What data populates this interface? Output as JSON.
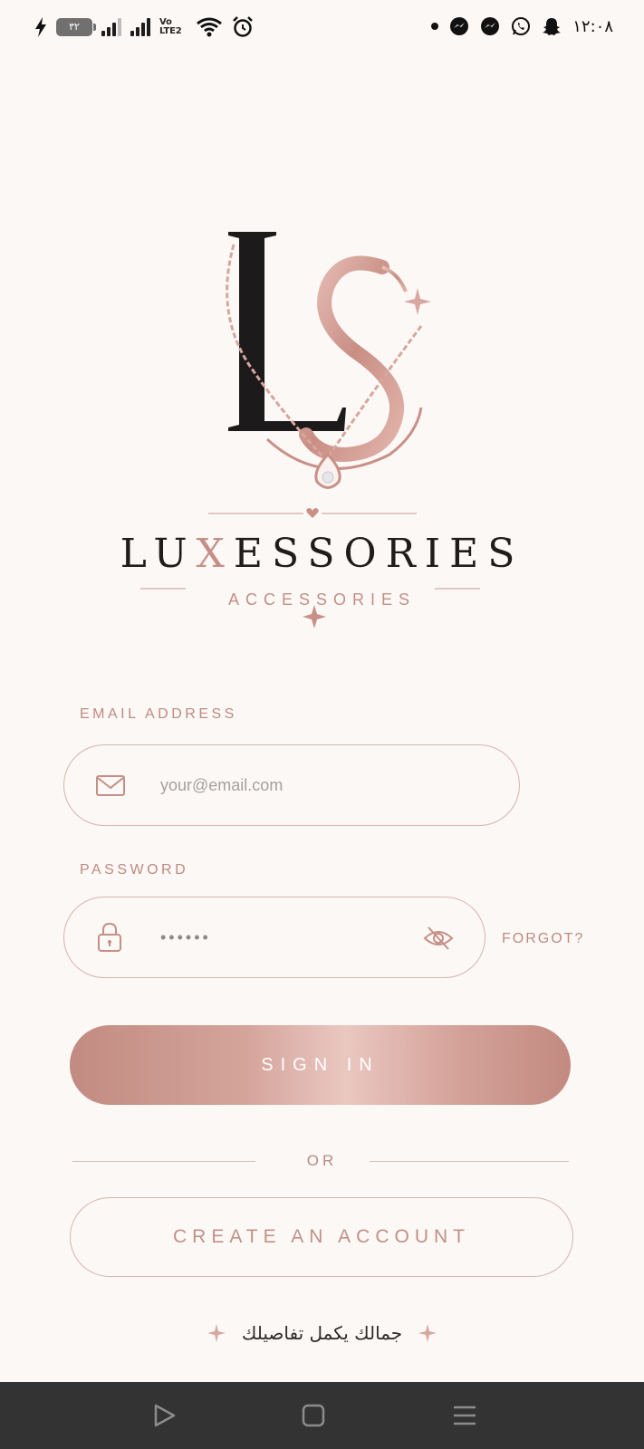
{
  "status_bar": {
    "battery_level": "٣٢",
    "network": "Vo LTE2",
    "time": "١٢:٠٨",
    "icons": [
      "charging-icon",
      "battery-icon",
      "signal-icon",
      "volte-icon",
      "wifi-icon",
      "alarm-icon",
      "notification-dot",
      "messenger-icon",
      "whatsapp-icon",
      "snapchat-icon"
    ]
  },
  "brand": {
    "name_pre": "LU",
    "name_x": "X",
    "name_post": "ESSORIES",
    "subtitle": "ACCESSORIES",
    "accent_color": "#C58F86"
  },
  "form": {
    "email_label": "EMAIL ADDRESS",
    "email_placeholder": "your@email.com",
    "email_value": "",
    "password_label": "PASSWORD",
    "password_value": "••••••",
    "forgot_label": "FORGOT?",
    "sign_in_label": "SIGN IN",
    "or_label": "OR",
    "create_account_label": "CREATE AN ACCOUNT"
  },
  "tagline": "جمالك يكمل تفاصيلك",
  "nav_bar": {
    "buttons": [
      "back-icon",
      "home-icon",
      "menu-icon"
    ]
  }
}
